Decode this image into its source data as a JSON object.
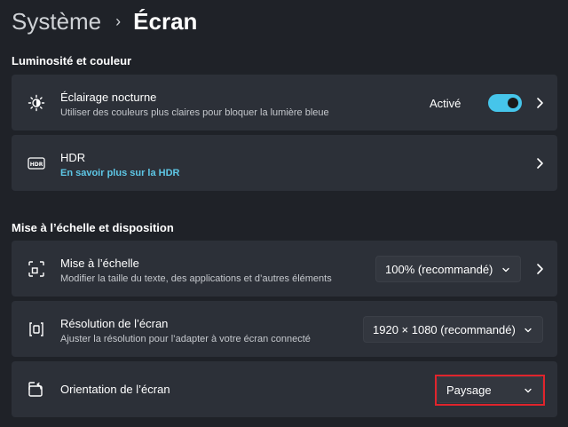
{
  "breadcrumb": {
    "parent": "Système",
    "separator": "›",
    "current": "Écran"
  },
  "sections": {
    "brightness": "Luminosité et couleur",
    "scale": "Mise à l’échelle et disposition"
  },
  "night_light": {
    "title": "Éclairage nocturne",
    "subtitle": "Utiliser des couleurs plus claires pour bloquer la lumière bleue",
    "status": "Activé",
    "toggle_on": true,
    "icon": "brightness-icon"
  },
  "hdr": {
    "title": "HDR",
    "link": "En savoir plus sur la HDR",
    "icon": "hdr-icon"
  },
  "scale": {
    "title": "Mise à l’échelle",
    "subtitle": "Modifier la taille du texte, des applications et d’autres éléments",
    "value": "100% (recommandé)",
    "icon": "scale-icon"
  },
  "resolution": {
    "title": "Résolution de l’écran",
    "subtitle": "Ajuster la résolution pour l’adapter à  votre  écran connecté",
    "value": "1920 × 1080 (recommandé)",
    "icon": "resolution-icon"
  },
  "orientation": {
    "title": "Orientation de l’écran",
    "value": "Paysage",
    "icon": "orientation-icon"
  },
  "colors": {
    "background": "#1f2228",
    "card": "#2c3038",
    "accent": "#46c5ea",
    "link": "#5ec7e6",
    "highlight": "#e0242c"
  }
}
